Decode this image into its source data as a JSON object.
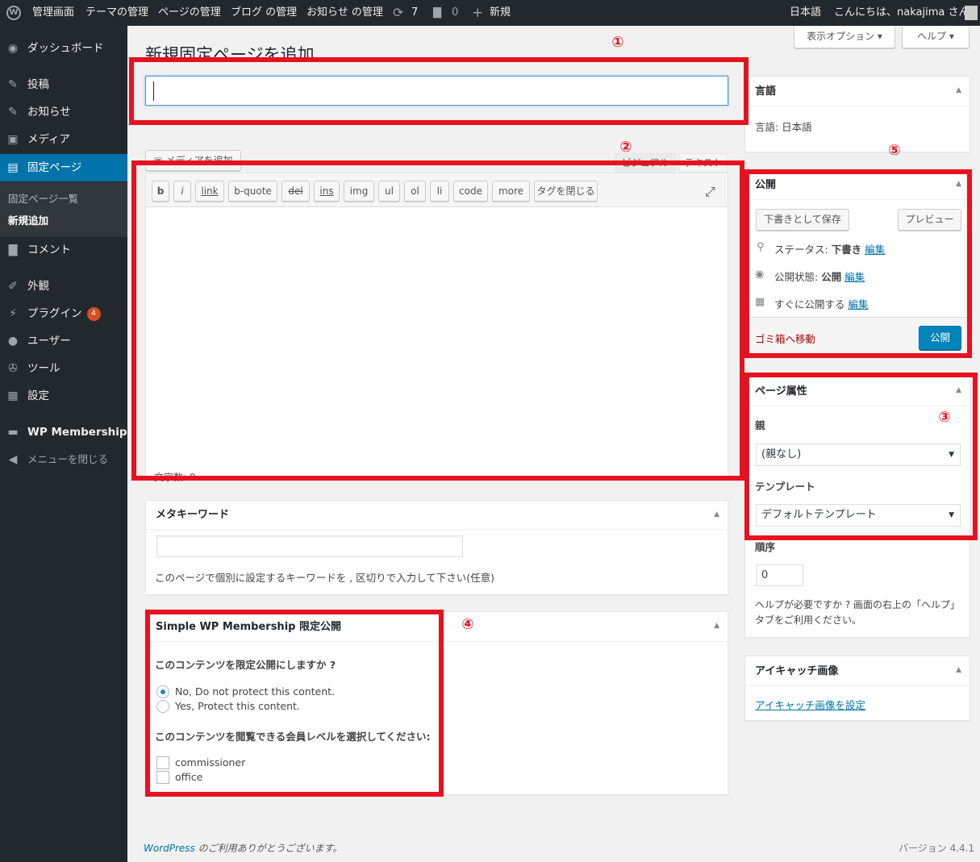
{
  "adminbar": {
    "site": "管理画面",
    "items": [
      "テーマの管理",
      "ページの管理",
      "ブログ の管理",
      "お知らせ の管理"
    ],
    "updates": "7",
    "comments": "0",
    "new": "新規",
    "lang": "日本語",
    "greeting": "こんにちは、nakajima さん !"
  },
  "sidebar": {
    "dashboard": "ダッシュボード",
    "posts": "投稿",
    "news": "お知らせ",
    "media": "メディア",
    "pages": "固定ページ",
    "pages_all": "固定ページ一覧",
    "pages_new": "新規追加",
    "comments": "コメント",
    "appearance": "外観",
    "plugins": "プラグイン",
    "plugins_badge": "4",
    "users": "ユーザー",
    "tools": "ツール",
    "settings": "設定",
    "membership": "WP Membership",
    "collapse": "メニューを閉じる"
  },
  "header": {
    "title": "新規固定ページを追加",
    "screen_options": "表示オプション",
    "help": "ヘルプ"
  },
  "editor": {
    "add_media": "メディアを追加",
    "tab_visual": "ビジュアル",
    "tab_text": "テキスト",
    "quicktags": [
      "b",
      "i",
      "link",
      "b-quote",
      "del",
      "ins",
      "img",
      "ul",
      "ol",
      "li",
      "code",
      "more",
      "タグを閉じる"
    ],
    "word_count": "文字数: 0"
  },
  "meta_keywords": {
    "title": "メタキーワード",
    "help": "このページで個別に設定するキーワードを , 区切りで入力して下さい(任意)"
  },
  "membership": {
    "title": "Simple WP Membership 限定公開",
    "question": "このコンテンツを限定公開にしますか ?",
    "opt_no": "No, Do not protect this content.",
    "opt_yes": "Yes, Protect this content.",
    "level_question": "このコンテンツを閲覧できる会員レベルを選択してください:",
    "levels": [
      "commissioner",
      "office"
    ]
  },
  "language_box": {
    "title": "言語",
    "value": "言語: 日本語"
  },
  "publish": {
    "title": "公開",
    "save_draft": "下書きとして保存",
    "preview": "プレビュー",
    "status_label": "ステータス:",
    "status_value": "下書き",
    "visibility_label": "公開状態:",
    "visibility_value": "公開",
    "schedule_label": "すぐに公開する",
    "edit": "編集",
    "trash": "ゴミ箱へ移動",
    "publish_btn": "公開"
  },
  "page_attr": {
    "title": "ページ属性",
    "parent_label": "親",
    "parent_value": "(親なし)",
    "template_label": "テンプレート",
    "template_value": "デフォルトテンプレート",
    "order_label": "順序",
    "order_value": "0",
    "help": "ヘルプが必要ですか ? 画面の右上の「ヘルプ」タブをご利用ください。"
  },
  "featured": {
    "title": "アイキャッチ画像",
    "link": "アイキャッチ画像を設定"
  },
  "footer": {
    "wp": "WordPress",
    "thanks": " のご利用ありがとうございます。",
    "version": "バージョン 4.4.1"
  },
  "annotations": [
    "①",
    "②",
    "③",
    "④",
    "⑤"
  ],
  "colors": {
    "annotation": "#e6121f",
    "accent": "#0073aa",
    "adminbar": "#23282d"
  }
}
